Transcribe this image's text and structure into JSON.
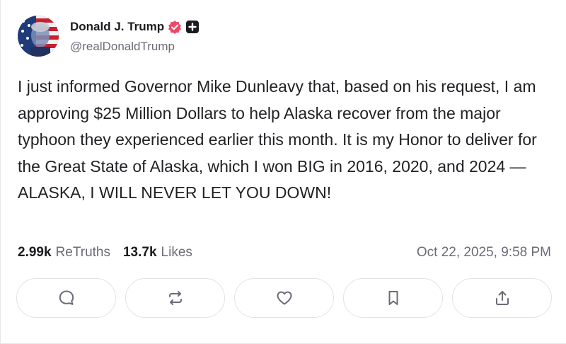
{
  "post": {
    "author": {
      "display_name": "Donald J. Trump",
      "handle": "@realDonaldTrump",
      "verified_icon": "verified-badge-icon",
      "plus_icon": "plus-badge-icon"
    },
    "text": "I just informed Governor Mike Dunleavy that, based on his request, I am approving $25 Million Dollars to help Alaska recover from the major typhoon they experienced earlier this month. It is my Honor to deliver for the Great State of Alaska, which I won BIG in 2016, 2020, and 2024 — ALASKA, I WILL NEVER LET YOU DOWN!",
    "stats": {
      "retruths_count": "2.99k",
      "retruths_label": "ReTruths",
      "likes_count": "13.7k",
      "likes_label": "Likes"
    },
    "timestamp": "Oct 22, 2025, 9:58 PM",
    "actions": [
      {
        "name": "reply",
        "icon": "comment-icon"
      },
      {
        "name": "retruth",
        "icon": "repost-icon"
      },
      {
        "name": "like",
        "icon": "heart-icon"
      },
      {
        "name": "bookmark",
        "icon": "bookmark-icon"
      },
      {
        "name": "share",
        "icon": "share-icon"
      }
    ]
  },
  "colors": {
    "verified_badge": "#ec4a6a",
    "muted_text": "#6b6b78",
    "border": "#e3e3e8"
  }
}
